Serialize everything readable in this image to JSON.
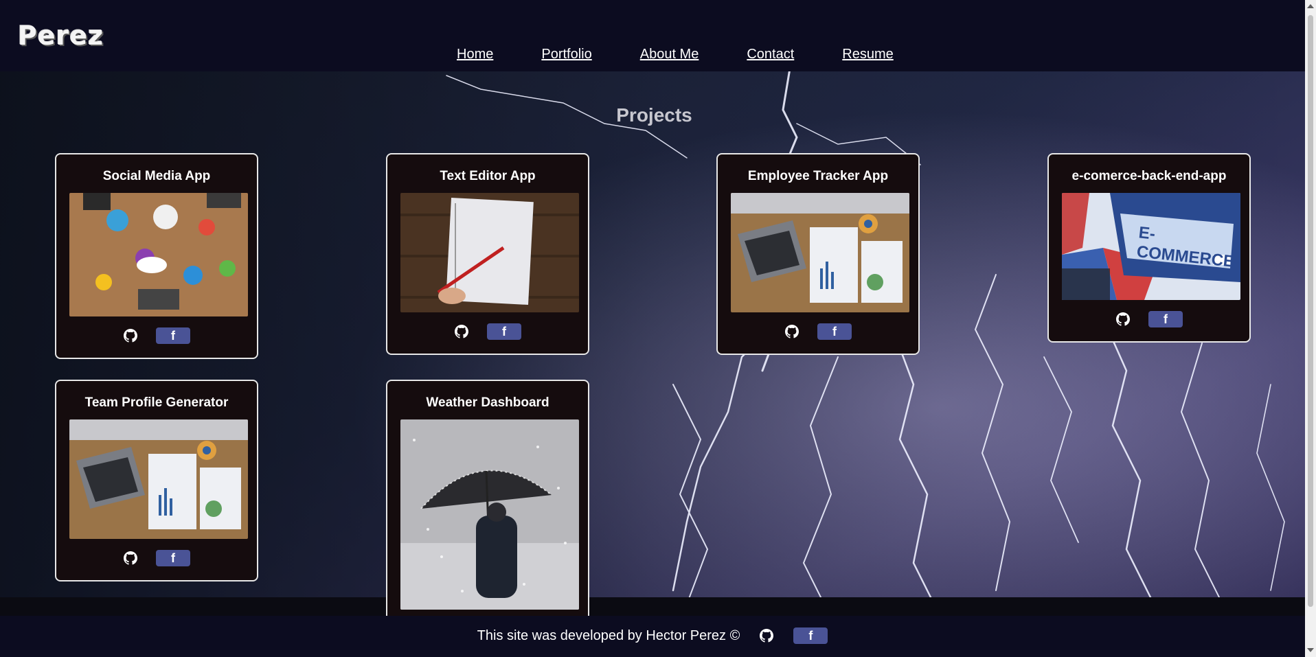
{
  "header": {
    "logo": "Perez",
    "nav": [
      "Home",
      "Portfolio",
      "About Me",
      "Contact",
      "Resume"
    ]
  },
  "main": {
    "title": "Projects",
    "projects": [
      {
        "title": "Social Media App",
        "image": "social-media-tabletop-photo",
        "github_icon": "github-icon",
        "facebook_label": "f"
      },
      {
        "title": "Text Editor App",
        "image": "notebook-and-pen-photo",
        "github_icon": "github-icon",
        "facebook_label": "f"
      },
      {
        "title": "Employee Tracker App",
        "image": "laptop-charts-desk-photo",
        "github_icon": "github-icon",
        "facebook_label": "f"
      },
      {
        "title": "e-comerce-back-end-app",
        "image": "e-commerce-binder-photo",
        "github_icon": "github-icon",
        "facebook_label": "f"
      },
      {
        "title": "Team Profile Generator",
        "image": "laptop-charts-desk-photo",
        "github_icon": "github-icon",
        "facebook_label": "f"
      },
      {
        "title": "Weather Dashboard",
        "image": "person-with-umbrella-snow-photo"
      }
    ]
  },
  "footer": {
    "text": "This site was developed by Hector Perez ©",
    "facebook_label": "f"
  },
  "colors": {
    "header_bg": "#0c0c20",
    "card_bg": "#150c0e",
    "card_border": "#e8e8e8",
    "facebook_button": "#4a5396"
  }
}
